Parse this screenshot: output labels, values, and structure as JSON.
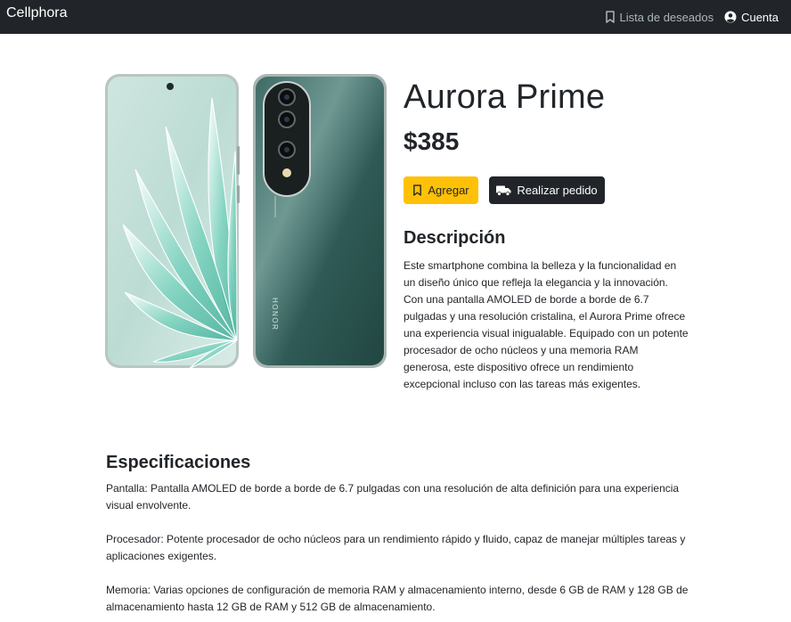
{
  "navbar": {
    "brand": "Cellphora",
    "wishlist_label": "Lista de deseados",
    "account_label": "Cuenta"
  },
  "product": {
    "name": "Aurora Prime",
    "price": "$385",
    "image_brand_text": "HONOR",
    "add_label": "Agregar",
    "order_label": "Realizar pedido",
    "description_heading": "Descripción",
    "description": "Este smartphone combina la belleza y la funcionalidad en un diseño único que refleja la elegancia y la innovación. Con una pantalla AMOLED de borde a borde de 6.7 pulgadas y una resolución cristalina, el Aurora Prime ofrece una experiencia visual inigualable. Equipado con un potente procesador de ocho núcleos y una memoria RAM generosa, este dispositivo ofrece un rendimiento excepcional incluso con las tareas más exigentes."
  },
  "specs": {
    "heading": "Especificaciones",
    "items": [
      "Pantalla: Pantalla AMOLED de borde a borde de 6.7 pulgadas con una resolución de alta definición para una experiencia visual envolvente.",
      "Procesador: Potente procesador de ocho núcleos para un rendimiento rápido y fluido, capaz de manejar múltiples tareas y aplicaciones exigentes.",
      "Memoria: Varias opciones de configuración de memoria RAM y almacenamiento interno, desde 6 GB de RAM y 128 GB de almacenamiento hasta 12 GB de RAM y 512 GB de almacenamiento."
    ]
  },
  "colors": {
    "navbar": "#212529",
    "accent_yellow": "#ffc107",
    "phone_back": "#2f5a55"
  }
}
